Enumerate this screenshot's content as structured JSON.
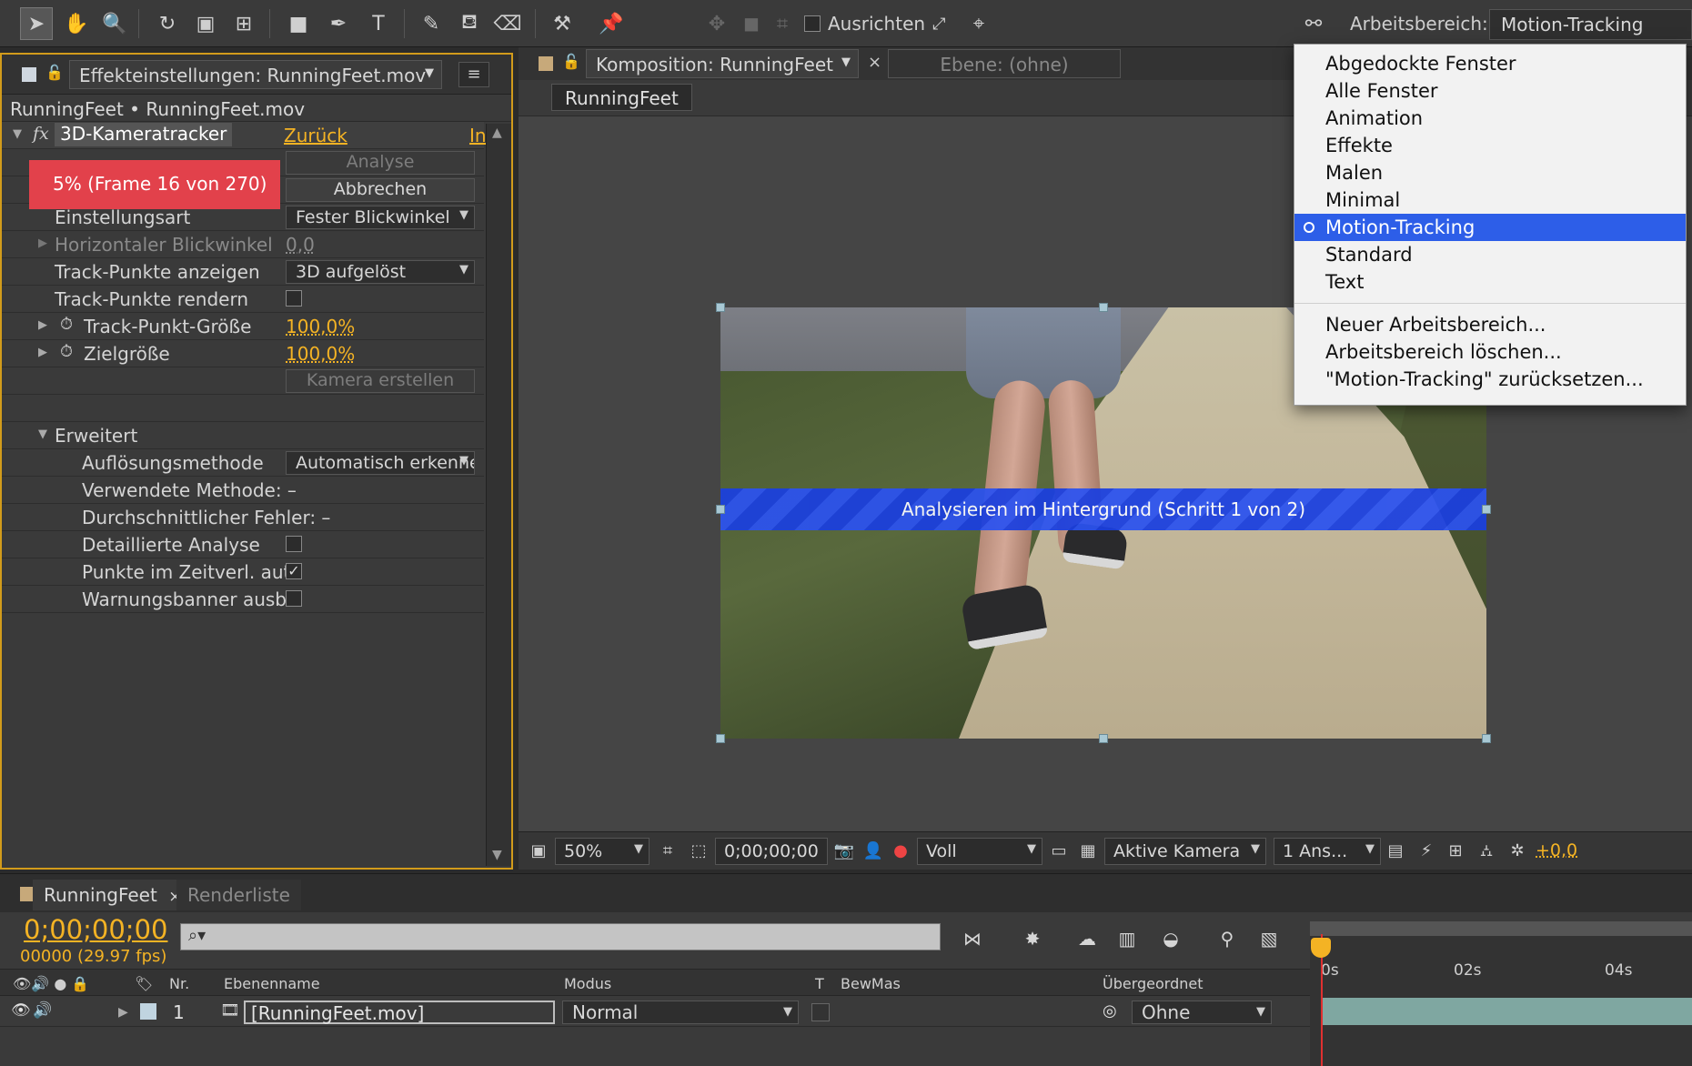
{
  "toolbar": {
    "snap_label": "Ausrichten",
    "workspace_label": "Arbeitsbereich:",
    "workspace_value": "Motion-Tracking"
  },
  "effects_panel": {
    "tab_label": "Effekteinstellungen: RunningFeet.mov",
    "breadcrumb": "RunningFeet • RunningFeet.mov",
    "effect_name": "3D-Kameratracker",
    "reset_link": "Zurück",
    "about_link": "In",
    "analyze_button": "Analyse",
    "cancel_button": "Abbrechen",
    "progress_text": "5% (Frame 16 von 270)",
    "rows": {
      "shot_type_label": "Einstellungsart",
      "shot_type_value": "Fester Blickwinkel",
      "hfov_label": "Horizontaler Blickwinkel",
      "hfov_value": "0,0",
      "show_points_label": "Track-Punkte anzeigen",
      "show_points_value": "3D aufgelöst",
      "render_points_label": "Track-Punkte rendern",
      "point_size_label": "Track-Punkt-Größe",
      "point_size_value": "100,0%",
      "target_size_label": "Zielgröße",
      "target_size_value": "100,0%",
      "create_camera_button": "Kamera erstellen",
      "advanced_label": "Erweitert",
      "solve_method_label": "Auflösungsmethode",
      "solve_method_value": "Automatisch erkennen",
      "method_used_label": "Verwendete Methode: –",
      "avg_error_label": "Durchschnittlicher Fehler: –",
      "detailed_analysis_label": "Detaillierte Analyse",
      "auto_delete_label": "Punkte im Zeitverl. aut",
      "hide_banner_label": "Warnungsbanner ausbl"
    }
  },
  "composition": {
    "tab_label": "Komposition: RunningFeet",
    "layer_tab_label": "Ebene: (ohne)",
    "comp_name": "RunningFeet",
    "banner_text": "Analysieren im Hintergrund (Schritt 1 von 2)",
    "footer": {
      "zoom": "50%",
      "timecode": "0;00;00;00",
      "resolution": "Voll",
      "camera": "Aktive Kamera",
      "views": "1 Ans...",
      "exposure": "+0,0"
    }
  },
  "workspace_menu": {
    "items": [
      "Abgedockte Fenster",
      "Alle Fenster",
      "Animation",
      "Effekte",
      "Malen",
      "Minimal",
      "Motion-Tracking",
      "Standard",
      "Text"
    ],
    "selected_index": 6,
    "actions": [
      "Neuer Arbeitsbereich...",
      "Arbeitsbereich löschen...",
      "\"Motion-Tracking\" zurücksetzen..."
    ]
  },
  "timeline": {
    "tab_comp": "RunningFeet",
    "tab_render": "Renderliste",
    "timecode": "0;00;00;00",
    "frame_fps": "00000 (29.97 fps)",
    "search_glyph": "⌕▾",
    "headers": {
      "nr": "Nr.",
      "layer_name": "Ebenenname",
      "mode": "Modus",
      "t": "T",
      "trkmat": "BewMas",
      "parent": "Übergeordnet"
    },
    "layer": {
      "number": "1",
      "name": "[RunningFeet.mov]",
      "mode": "Normal",
      "parent": "Ohne"
    },
    "ruler": [
      "0s",
      "02s",
      "04s"
    ]
  },
  "colors": {
    "accent_orange": "#f4b324",
    "panel_highlight": "#d29b1b",
    "progress_red": "#e2414b",
    "menu_selection": "#2d5ee8",
    "banner_blue": "#1a3fe0"
  }
}
